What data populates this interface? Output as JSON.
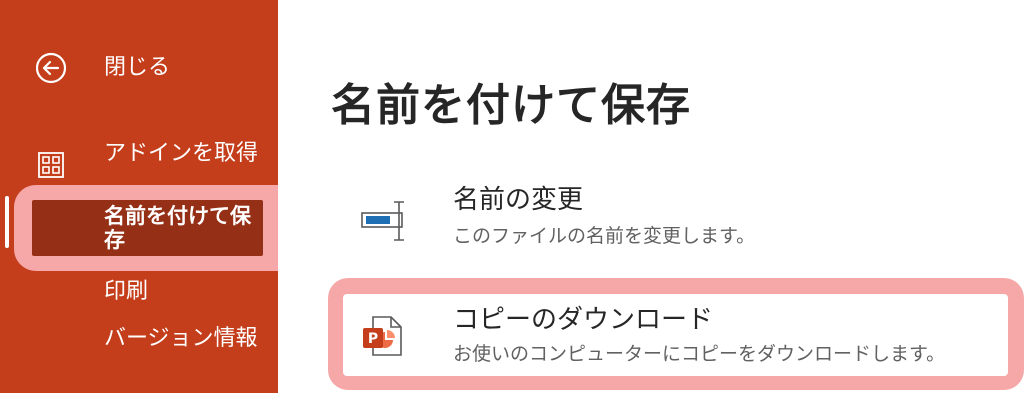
{
  "sidebar": {
    "items": [
      {
        "label": "閉じる",
        "icon": "back-arrow-icon"
      },
      {
        "label": "アドインを取得",
        "icon": "grid-icon"
      },
      {
        "label": "名前を付けて保存",
        "selected": true
      },
      {
        "label": "印刷"
      },
      {
        "label": "バージョン情報"
      }
    ]
  },
  "main": {
    "title": "名前を付けて保存",
    "options": [
      {
        "title": "名前の変更",
        "description": "このファイルの名前を変更します。",
        "icon": "rename-icon"
      },
      {
        "title": "コピーのダウンロード",
        "description": "お使いのコンピューターにコピーをダウンロードします。",
        "icon": "powerpoint-file-icon"
      }
    ]
  },
  "colors": {
    "sidebar_bg": "#c43e1c",
    "selected_bg": "#952f15",
    "highlight": "#f6a8a8",
    "accent_blue": "#1f6fb5",
    "ppt_orange": "#c43e1c"
  }
}
